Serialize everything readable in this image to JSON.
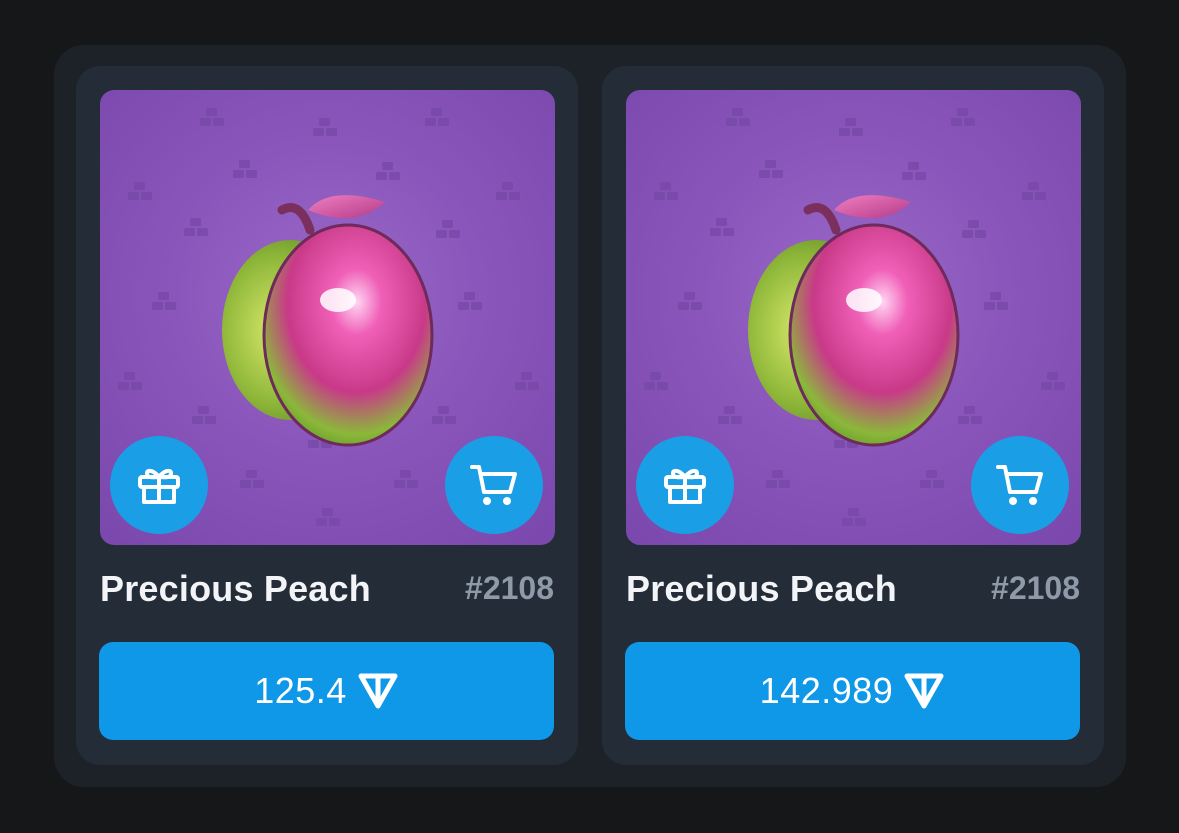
{
  "cards": [
    {
      "name": "Precious Peach",
      "number": "#2108",
      "price": "125.4",
      "currency_icon": "ton-icon"
    },
    {
      "name": "Precious Peach",
      "number": "#2108",
      "price": "142.989",
      "currency_icon": "ton-icon"
    }
  ],
  "icons": {
    "gift": "gift-icon",
    "cart": "cart-icon"
  },
  "colors": {
    "page_background": "#161718",
    "container_background": "#1d2229",
    "card_background": "#232c37",
    "art_background": "#8a56bb",
    "accent_blue": "#0f98e8",
    "title_text": "#f2f4f7",
    "number_text": "#8f9aa8"
  }
}
